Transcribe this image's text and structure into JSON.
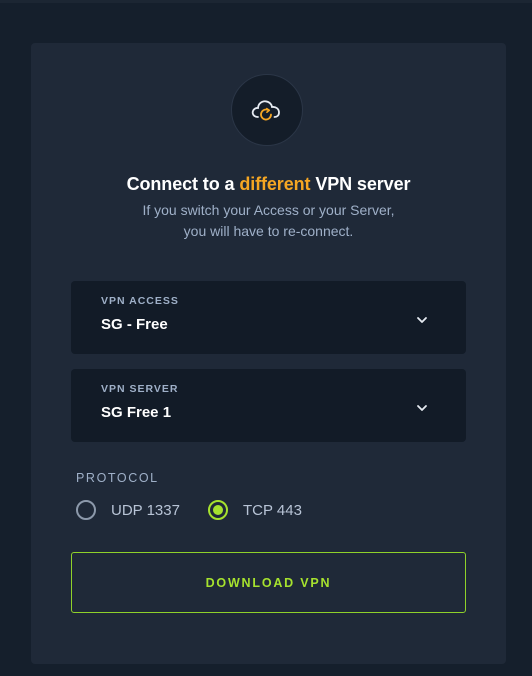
{
  "card": {
    "icon": "cloud-refresh-icon",
    "title_pre": "Connect to a ",
    "title_highlight": "different",
    "title_post": " VPN server",
    "subtitle_line1": "If you switch your Access or your Server,",
    "subtitle_line2": "you will have to re-connect."
  },
  "vpn_access": {
    "label": "VPN ACCESS",
    "value": "SG - Free",
    "icon": "chevron-down-icon"
  },
  "vpn_server": {
    "label": "VPN SERVER",
    "value": "SG Free 1",
    "icon": "chevron-down-icon"
  },
  "protocol": {
    "label": "PROTOCOL",
    "options": [
      {
        "label": "UDP 1337",
        "selected": false
      },
      {
        "label": "TCP 443",
        "selected": true
      }
    ]
  },
  "download_button": {
    "label": "DOWNLOAD VPN"
  },
  "colors": {
    "accent_orange": "#f5a623",
    "accent_green": "#a6e22e",
    "background": "#151f2c",
    "panel": "#1f2938"
  }
}
